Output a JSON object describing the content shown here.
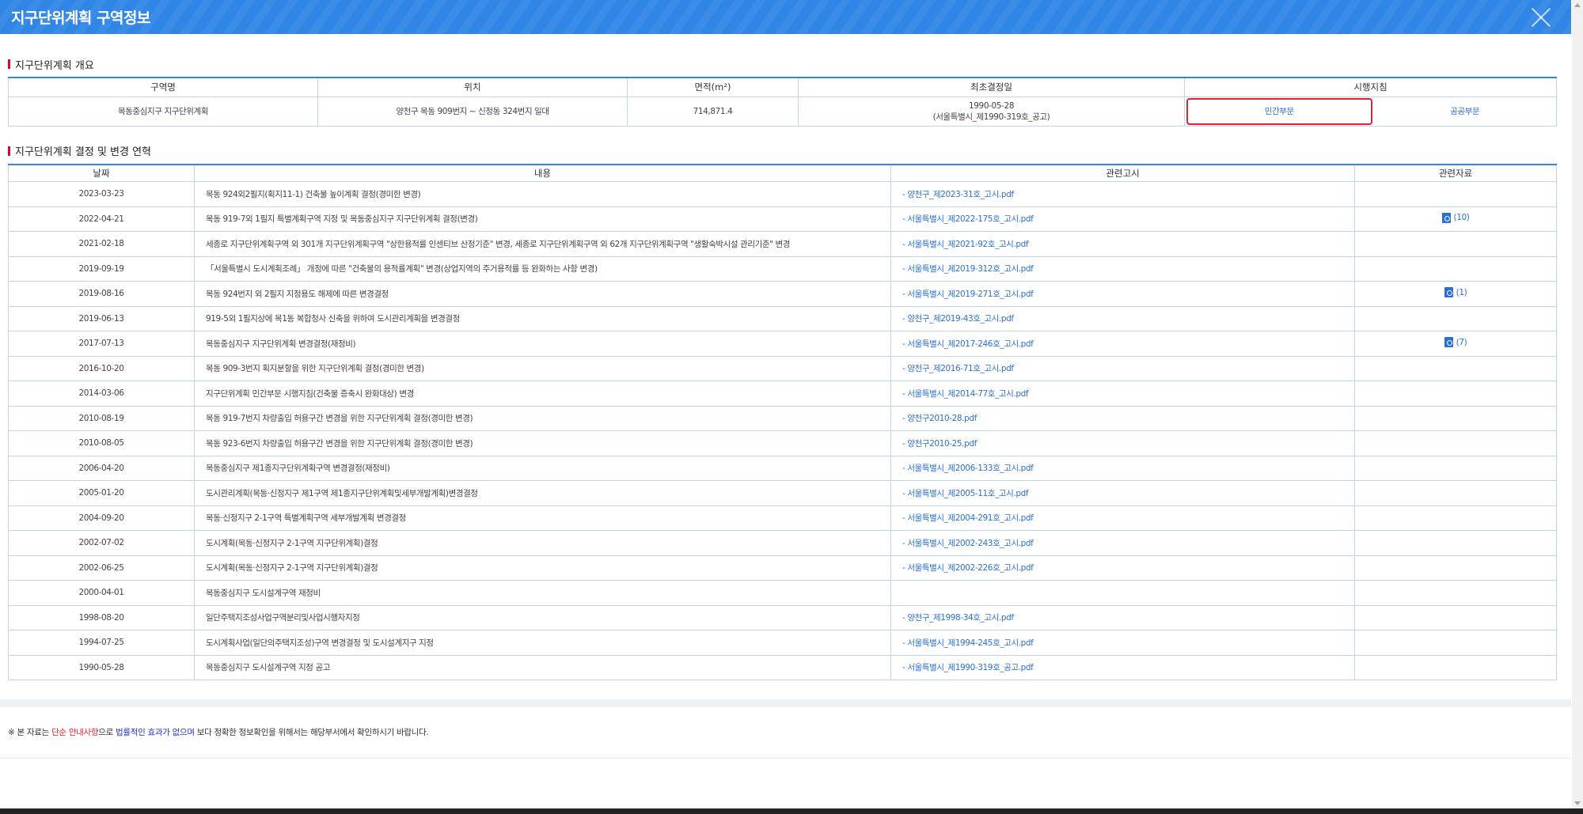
{
  "header": {
    "title": "지구단위계획 구역정보"
  },
  "overview": {
    "section_title": "지구단위계획 개요",
    "columns": {
      "name": "구역명",
      "location": "위치",
      "area": "면적(m²)",
      "first_date": "최초결정일",
      "guide": "시행지침"
    },
    "row": {
      "name": "목동중심지구 지구단위계획",
      "location": "양천구 목동 909번지 ~ 신정동 324번지 일대",
      "area": "714,871.4",
      "first_date": "1990-05-28",
      "first_date_note": "(서울특별시_제1990-319호_공고)",
      "guide_private": "민간부문",
      "guide_public": "공공부문"
    }
  },
  "history": {
    "section_title": "지구단위계획 결정 및 변경 연혁",
    "columns": {
      "date": "날짜",
      "content": "내용",
      "notice": "관련고시",
      "data": "관련자료"
    },
    "rows": [
      {
        "date": "2023-03-23",
        "content": "목동 924외2필지(획지11-1) 건축물 높이계획 결정(경미한 변경)",
        "notice": "- 양천구_제2023-31호_고시.pdf",
        "data": ""
      },
      {
        "date": "2022-04-21",
        "content": "목동 919-7외 1필지 특별계획구역 지정 및 목동중심지구 지구단위계획 결정(변경)",
        "notice": "- 서울특별시_제2022-175호_고시.pdf",
        "data": "(10)"
      },
      {
        "date": "2021-02-18",
        "content": "세종로 지구단위계획구역 외 301개 지구단위계획구역 \"상한용적률 인센티브 산정기준\" 변경, 세종로 지구단위계획구역 외 62개 지구단위계획구역 \"생활숙박시설 관리기준\" 변경",
        "notice": "- 서울특별시_제2021-92호_고시.pdf",
        "data": ""
      },
      {
        "date": "2019-09-19",
        "content": "「서울특별시 도시계획조례」 개정에 따른 \"건축물의 용적률계획\" 변경(상업지역의 주거용적률 등 완화하는 사항 변경)",
        "notice": "- 서울특별시_제2019-312호_고시.pdf",
        "data": ""
      },
      {
        "date": "2019-08-16",
        "content": "목동 924번지 외 2필지 지정용도 해제에 따른 변경결정",
        "notice": "- 서울특별시_제2019-271호_고시.pdf",
        "data": "(1)"
      },
      {
        "date": "2019-06-13",
        "content": "919-5외 1필지상에 목1동 복합청사 신축을 위하여 도시관리계획을 변경결정",
        "notice": "- 양천구_제2019-43호_고시.pdf",
        "data": ""
      },
      {
        "date": "2017-07-13",
        "content": "목동중심지구 지구단위계획 변경결정(재정비)",
        "notice": "- 서울특별시_제2017-246호_고시.pdf",
        "data": "(7)"
      },
      {
        "date": "2016-10-20",
        "content": "목동 909-3번지 획지분할을 위한 지구단위계획 결정(경미한 변경)",
        "notice": "- 양천구_제2016-71호_고시.pdf",
        "data": ""
      },
      {
        "date": "2014-03-06",
        "content": "지구단위계획 민간부문 시행지침(건축물 증축시 완화대상) 변경",
        "notice": "- 서울특별시_제2014-77호_고시.pdf",
        "data": ""
      },
      {
        "date": "2010-08-19",
        "content": "목동 919-7번지 차량출입 허용구간 변경을 위한 지구단위계획 결정(경미한 변경)",
        "notice": "- 양천구2010-28.pdf",
        "data": ""
      },
      {
        "date": "2010-08-05",
        "content": "목동 923-6번지 차량출입 허용구간 변경을 위한 지구단위계획 결정(경미한 변경)",
        "notice": "- 양천구2010-25.pdf",
        "data": ""
      },
      {
        "date": "2006-04-20",
        "content": "목동중심지구 제1종지구단위계획구역 변경결정(재정비)",
        "notice": "- 서울특별시_제2006-133호_고시.pdf",
        "data": ""
      },
      {
        "date": "2005-01-20",
        "content": "도시관리계획(목동·신정지구 제1구역 제1종지구단위계획및세부개발계획)변경결정",
        "notice": "- 서울특별시_제2005-11호_고시.pdf",
        "data": ""
      },
      {
        "date": "2004-09-20",
        "content": "목동·신정지구 2-1구역 특별계획구역 세부개발계획 변경결정",
        "notice": "- 서울특별시_제2004-291호_고시.pdf",
        "data": ""
      },
      {
        "date": "2002-07-02",
        "content": "도시계획(목동·신정지구 2-1구역 지구단위계획)결정",
        "notice": "- 서울특별시_제2002-243호_고시.pdf",
        "data": ""
      },
      {
        "date": "2002-06-25",
        "content": "도시계획(목동·신정지구 2-1구역 지구단위계획)결정",
        "notice": "- 서울특별시_제2002-226호_고시.pdf",
        "data": ""
      },
      {
        "date": "2000-04-01",
        "content": "목동중심지구 도시설계구역 재정비",
        "notice": "",
        "data": ""
      },
      {
        "date": "1998-08-20",
        "content": "일단주택지조성사업구역분리및사업시행자지정",
        "notice": "- 양천구_제1998-34호_고시.pdf",
        "data": ""
      },
      {
        "date": "1994-07-25",
        "content": "도시계획사업(일단의주택지조성)구역 변경결정 및 도시설계지구 지정",
        "notice": "- 서울특별시_제1994-245호_고시.pdf",
        "data": ""
      },
      {
        "date": "1990-05-28",
        "content": "목동중심지구 도시설계구역 지정 공고",
        "notice": "- 서울특별시_제1990-319호_공고.pdf",
        "data": ""
      }
    ]
  },
  "footer_notice": {
    "prefix": "※ 본 자료는 ",
    "red": "단순 안내사항",
    "mid": "으로 ",
    "blue": "법률적인 효과가 없으며",
    "suffix": " 보다 정확한 정보확인을 위해서는 해당부서에서 확인하시기 바랍니다."
  },
  "colors": {
    "header_blue": "#2f86e6",
    "link_blue": "#2a6fd6",
    "highlight_red": "#e0212e"
  }
}
